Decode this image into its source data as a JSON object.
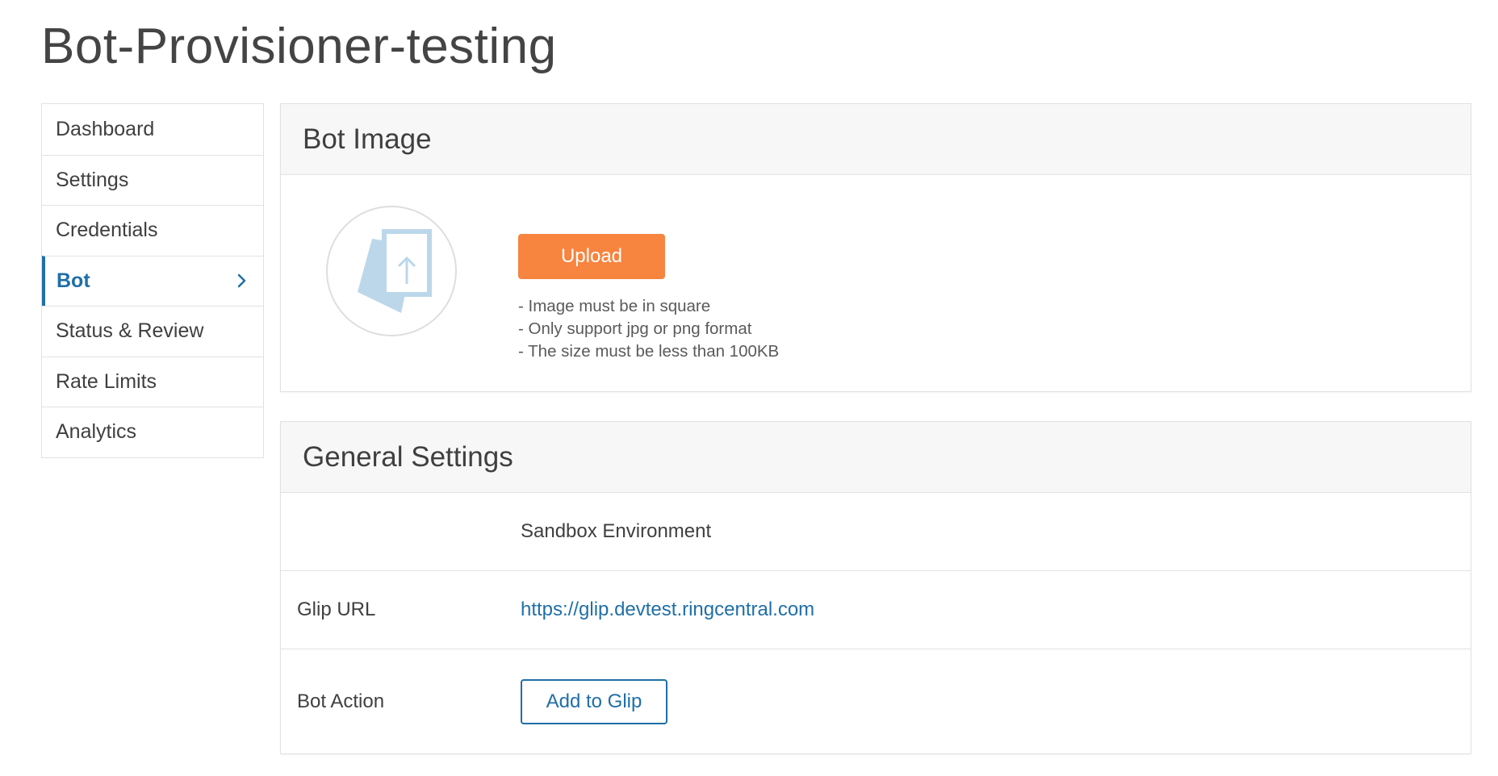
{
  "app": {
    "title": "Bot-Provisioner-testing"
  },
  "sidebar": {
    "items": [
      {
        "label": "Dashboard"
      },
      {
        "label": "Settings"
      },
      {
        "label": "Credentials"
      },
      {
        "label": "Bot",
        "active": true
      },
      {
        "label": "Status & Review"
      },
      {
        "label": "Rate Limits"
      },
      {
        "label": "Analytics"
      }
    ],
    "active_icon": "chevron-right-icon"
  },
  "bot_image": {
    "title": "Bot Image",
    "placeholder_icon": "image-upload-icon",
    "upload_label": "Upload",
    "rules": [
      "- Image must be in square",
      "- Only support jpg or png format",
      "- The size must be less than 100KB"
    ]
  },
  "general_settings": {
    "title": "General Settings",
    "environment_heading": "Sandbox Environment",
    "glip_url_label": "Glip URL",
    "glip_url": "https://glip.devtest.ringcentral.com",
    "bot_action_label": "Bot Action",
    "add_to_glip_label": "Add to Glip"
  },
  "colors": {
    "accent_blue": "#1f6fa8",
    "upload_orange": "#f7843f",
    "panel_header_bg": "#f7f7f7",
    "border": "#e2e2e2"
  }
}
